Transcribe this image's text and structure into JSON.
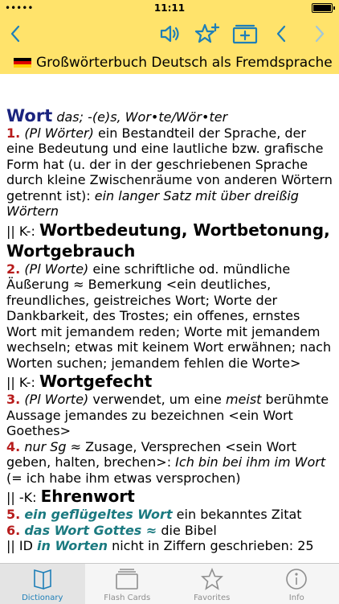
{
  "status_bar": {
    "time": "11:11"
  },
  "book_title": "Großwörterbuch Deutsch als Fremdsprache",
  "colors": {
    "accent": "#1e7fb8",
    "bar": "#ffe36b",
    "numbers": "#b71c1c",
    "headword": "#1a237e",
    "idiom": "#1b7a80"
  },
  "entry": {
    "headword": "Wort",
    "grammar": "das; -(e)s, Wor•te/Wör•ter",
    "s1_num": "1.",
    "s1_gram": "(Pl Wörter)",
    "s1_def": " ein Bestandteil der Sprache, der eine Bedeutung und eine lautliche bzw. grafische Form hat (u. der in der geschriebenen Sprache durch kleine Zwischenräume von anderen Wörtern getrennt ist): ",
    "s1_ex": "ein langer Satz mit über dreißig Wörtern",
    "k1_prefix": "|| K-: ",
    "k1_a": "Wortbedeutung",
    "k1_sep1": ", ",
    "k1_b": "Wortbetonung",
    "k1_sep2": ", ",
    "k1_c": "Wortgebrauch",
    "s2_num": "2.",
    "s2_gram": "(Pl Worte)",
    "s2_def": " eine schriftliche od. mündliche Äußerung ≈ Bemerkung <ein deutliches, freundliches, geistreiches Wort; Worte der Dankbarkeit, des Trostes; ein offenes, ernstes Wort mit jemandem reden; Worte mit jemandem wechseln; etwas mit keinem Wort erwähnen; nach Worten suchen; jemandem fehlen die Worte>",
    "k2_prefix": "|| K-: ",
    "k2_a": "Wortgefecht",
    "s3_num": "3.",
    "s3_gram": "(Pl Worte)",
    "s3_def_a": " verwendet, um eine ",
    "s3_meist": "meist",
    "s3_def_b": " berühmte Aussage jemandes zu bezeichnen <ein Wort Goethes>",
    "s4_num": "4.",
    "s4_gram": "nur Sg",
    "s4_def": " ≈ Zusage, Versprechen <sein Wort geben, halten, brechen>: ",
    "s4_ex": "Ich bin bei ihm im Wort",
    "s4_note": " (= ich habe ihm etwas versprochen)",
    "k3_prefix": "|| -K: ",
    "k3_a": "Ehrenwort",
    "s5_num": "5.",
    "s5_idiom": "ein geflügeltes Wort",
    "s5_def": " ein bekanntes Zitat",
    "s6_num": "6.",
    "s6_idiom": "das Wort Gottes ≈",
    "s6_def": " die Bibel",
    "id_prefix": "|| ID ",
    "id_idiom": "in Worten",
    "id_def": " nicht in Ziffern geschrieben: 25"
  },
  "tabs": [
    {
      "label": "Dictionary",
      "icon": "book-icon"
    },
    {
      "label": "Flash Cards",
      "icon": "cards-icon"
    },
    {
      "label": "Favorites",
      "icon": "star-icon"
    },
    {
      "label": "Info",
      "icon": "info-icon"
    }
  ]
}
